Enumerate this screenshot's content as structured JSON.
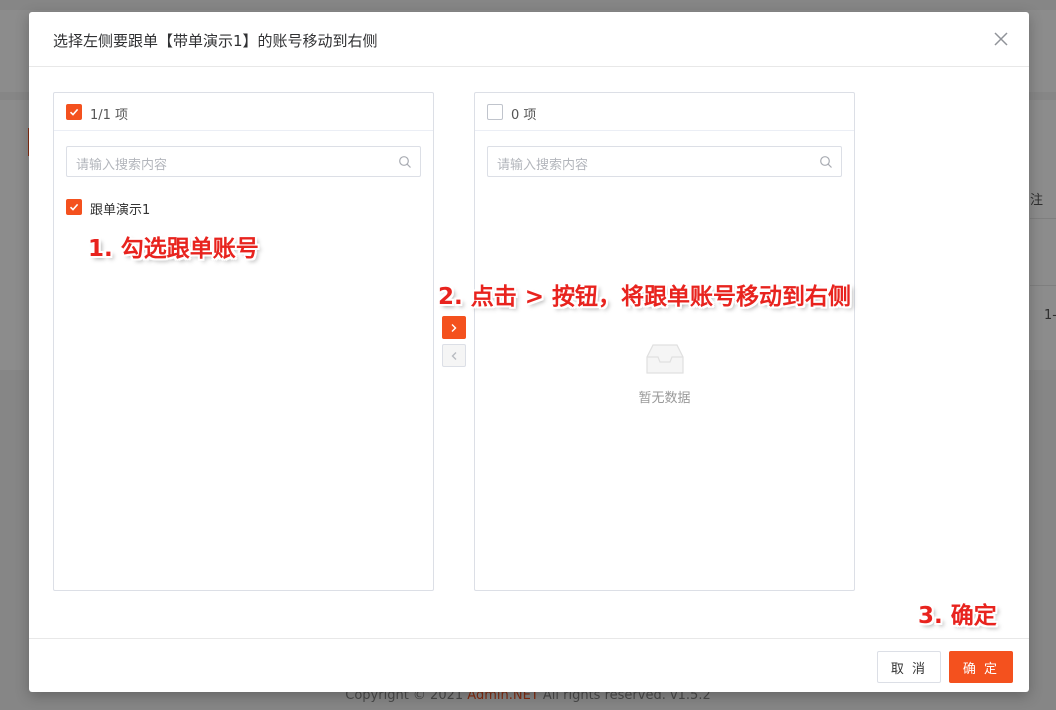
{
  "background": {
    "column_header_fragment": "注",
    "row_fragment": "1-",
    "footer_prefix": "Copyright © 2021",
    "footer_brand": "Admin.NET",
    "footer_suffix": "All rights reserved. v1.5.2"
  },
  "dialog": {
    "title": "选择左侧要跟单【带单演示1】的账号移动到右侧",
    "close_icon": "close-icon"
  },
  "left_panel": {
    "count": "1/1 项",
    "checked": true,
    "search_placeholder": "请输入搜索内容",
    "items": [
      {
        "label": "跟单演示1",
        "checked": true
      }
    ]
  },
  "right_panel": {
    "count": "0 项",
    "checked": false,
    "search_placeholder": "请输入搜索内容",
    "empty_text": "暂无数据"
  },
  "transfer": {
    "to_right_icon": "chevron-right-icon",
    "to_left_icon": "chevron-left-icon"
  },
  "footer": {
    "cancel_label": "取 消",
    "ok_label": "确 定"
  },
  "annotations": {
    "step1": "1. 勾选跟单账号",
    "step2": "2. 点击 > 按钮，将跟单账号移动到右侧",
    "step3": "3. 确定"
  },
  "colors": {
    "accent": "#f4511e",
    "annotation": "#e8231e"
  }
}
